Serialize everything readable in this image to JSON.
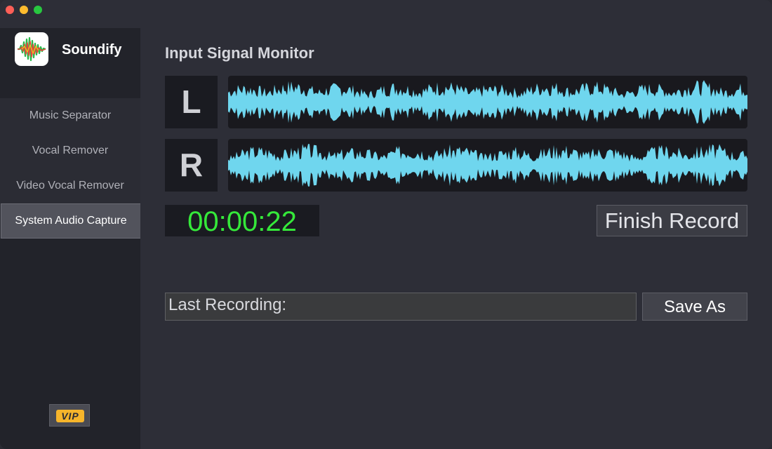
{
  "app": {
    "name": "Soundify",
    "icon": "waveform-app-icon"
  },
  "sidebar": {
    "items": [
      {
        "label": "Music Separator",
        "active": false
      },
      {
        "label": "Vocal Remover",
        "active": false
      },
      {
        "label": "Video Vocal Remover",
        "active": false
      },
      {
        "label": "System Audio Capture",
        "active": true
      }
    ],
    "vip_label": "VIP"
  },
  "main": {
    "title": "Input Signal Monitor",
    "channels": {
      "left_label": "L",
      "right_label": "R"
    },
    "timer": "00:00:22",
    "finish_button": "Finish Record",
    "last_recording_label": "Last Recording:",
    "save_as_button": "Save As"
  },
  "colors": {
    "waveform": "#6fd6ee",
    "timer": "#35e83a",
    "vip_badge": "#f6b52b",
    "active_item": "#52535c"
  }
}
